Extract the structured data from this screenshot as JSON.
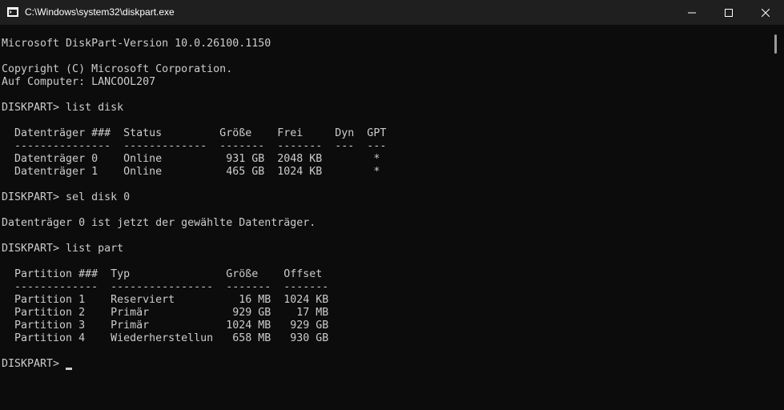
{
  "window": {
    "title": "C:\\Windows\\system32\\diskpart.exe",
    "icon": "console-app-icon",
    "controls": [
      "minimize-icon",
      "maximize-icon",
      "close-icon"
    ]
  },
  "console": {
    "lines": [
      "Microsoft DiskPart-Version 10.0.26100.1150",
      "",
      "Copyright (C) Microsoft Corporation.",
      "Auf Computer: LANCOOL207",
      "",
      "DISKPART> list disk",
      "",
      "  Datenträger ###  Status         Größe    Frei     Dyn  GPT",
      "  ---------------  -------------  -------  -------  ---  ---",
      "  Datenträger 0    Online          931 GB  2048 KB        *",
      "  Datenträger 1    Online          465 GB  1024 KB        *",
      "",
      "DISKPART> sel disk 0",
      "",
      "Datenträger 0 ist jetzt der gewählte Datenträger.",
      "",
      "DISKPART> list part",
      "",
      "  Partition ###  Typ               Größe    Offset",
      "  -------------  ----------------  -------  -------",
      "  Partition 1    Reserviert          16 MB  1024 KB",
      "  Partition 2    Primär             929 GB    17 MB",
      "  Partition 3    Primär            1024 MB   929 GB",
      "  Partition 4    Wiederherstellun   658 MB   930 GB",
      "",
      "DISKPART> "
    ]
  },
  "colors": {
    "background": "#0c0c0c",
    "titlebar": "#1f1f1f",
    "text": "#cccccc"
  }
}
